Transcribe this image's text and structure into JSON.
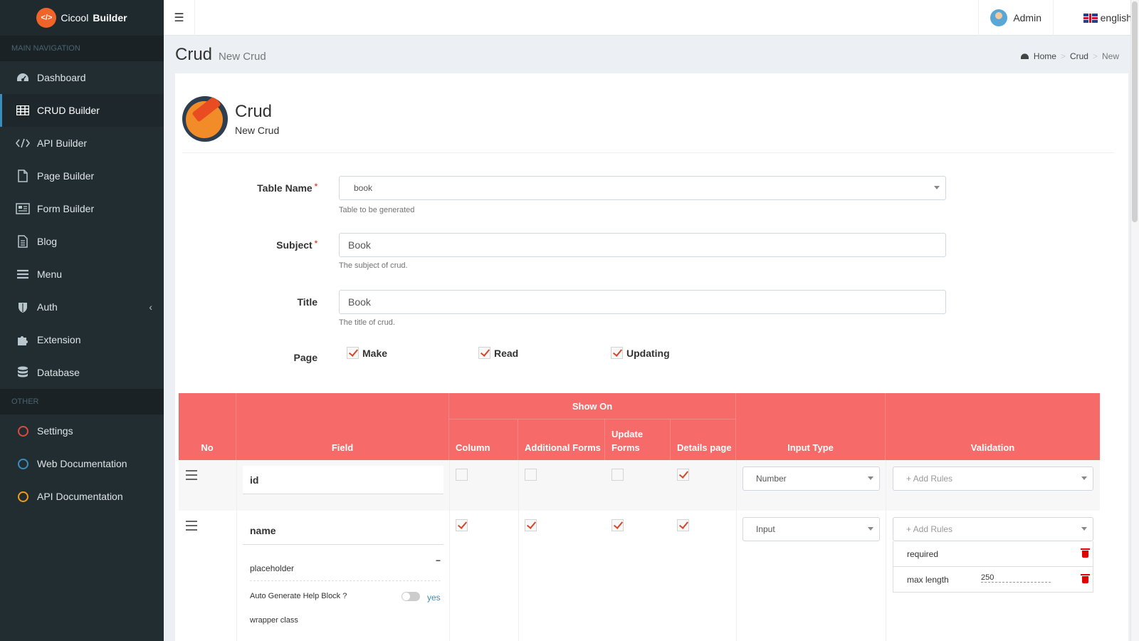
{
  "app": {
    "logo_badge": "</>",
    "name_part1": "Cicool",
    "name_part2": "Builder"
  },
  "sidebar": {
    "section_main": "MAIN NAVIGATION",
    "items": [
      {
        "label": "Dashboard",
        "icon": "dashboard-icon"
      },
      {
        "label": "CRUD Builder",
        "icon": "table-icon",
        "active": true
      },
      {
        "label": "API Builder",
        "icon": "code-icon"
      },
      {
        "label": "Page Builder",
        "icon": "file-icon"
      },
      {
        "label": "Form Builder",
        "icon": "form-icon"
      },
      {
        "label": "Blog",
        "icon": "document-icon"
      },
      {
        "label": "Menu",
        "icon": "bars-icon"
      },
      {
        "label": "Auth",
        "icon": "shield-icon"
      },
      {
        "label": "Extension",
        "icon": "puzzle-icon"
      },
      {
        "label": "Database",
        "icon": "database-icon"
      }
    ],
    "section_other": "OTHER",
    "other_items": [
      {
        "label": "Settings",
        "color": "#dd4b39"
      },
      {
        "label": "Web Documentation",
        "color": "#3c8dbc"
      },
      {
        "label": "API Documentation",
        "color": "#f39c12"
      }
    ]
  },
  "topbar": {
    "user": "Admin",
    "language": "english"
  },
  "page": {
    "title": "Crud",
    "subtitle": "New Crud"
  },
  "breadcrumb": {
    "home": "Home",
    "crud": "Crud",
    "current": "New"
  },
  "box": {
    "title": "Crud",
    "subtitle": "New Crud"
  },
  "form": {
    "table_name": {
      "label": "Table Name",
      "value": "book",
      "help": "Table to be generated"
    },
    "subject": {
      "label": "Subject",
      "value": "Book",
      "help": "The subject of crud."
    },
    "title": {
      "label": "Title",
      "value": "Book",
      "help": "The title of crud."
    },
    "page": {
      "label": "Page",
      "options": [
        {
          "label": "Make",
          "checked": true
        },
        {
          "label": "Read",
          "checked": true
        },
        {
          "label": "Updating",
          "checked": true
        }
      ]
    }
  },
  "table": {
    "headers": {
      "no": "No",
      "field": "Field",
      "show_on": "Show On",
      "column": "Column",
      "additional_forms": "Additional Forms",
      "update_forms_1": "Update",
      "update_forms_2": "Forms",
      "details_page": "Details page",
      "input_type": "Input Type",
      "validation": "Validation"
    },
    "rows": [
      {
        "field": "id",
        "column": false,
        "additional": false,
        "update": false,
        "details": true,
        "input_type": "Number",
        "rules_placeholder": "+ Add Rules"
      },
      {
        "field": "name",
        "column": true,
        "additional": true,
        "update": true,
        "details": true,
        "input_type": "Input",
        "rules_placeholder": "+ Add Rules",
        "placeholder_label": "placeholder",
        "collapse_symbol": "−",
        "auto_help_label": "Auto Generate Help Block ?",
        "auto_help_value": "yes",
        "wrapper_class_label": "wrapper class",
        "rules": [
          {
            "name": "required",
            "value": ""
          },
          {
            "name": "max length",
            "value": "250"
          }
        ]
      }
    ]
  },
  "colors": {
    "header_red": "#f66b6a",
    "sidebar": "#222d32",
    "accent": "#3c8dbc"
  }
}
